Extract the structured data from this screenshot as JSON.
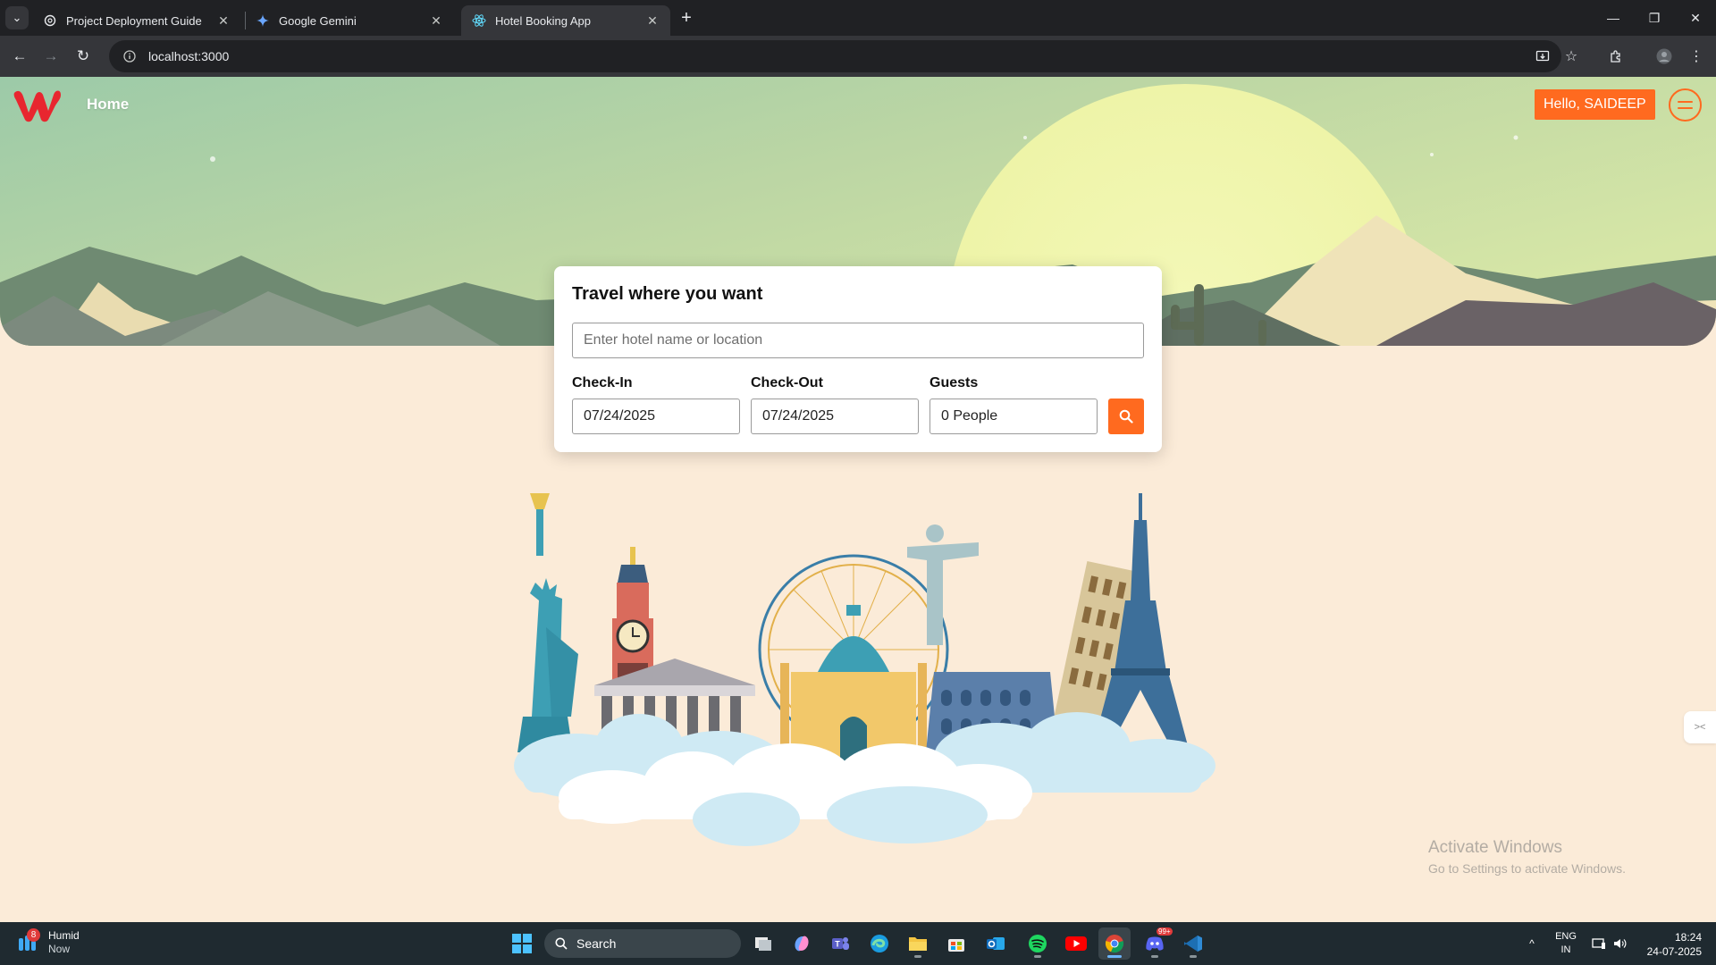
{
  "browser": {
    "tabs": [
      {
        "title": "Project Deployment Guide",
        "icon": "openai-icon",
        "active": false
      },
      {
        "title": "Google Gemini",
        "icon": "gemini-icon",
        "active": false
      },
      {
        "title": "Hotel Booking App",
        "icon": "react-icon",
        "active": true
      }
    ],
    "url": "localhost:3000"
  },
  "app": {
    "nav": {
      "home_label": "Home"
    },
    "greeting": "Hello, SAIDEEP",
    "search": {
      "title": "Travel where you want",
      "placeholder": "Enter hotel name or location",
      "checkin_label": "Check-In",
      "checkin_value": "07/24/2025",
      "checkout_label": "Check-Out",
      "checkout_value": "07/24/2025",
      "guests_label": "Guests",
      "guests_value": "0 People"
    },
    "accent_color": "#ff6a1f",
    "background_color": "#fbebd8"
  },
  "watermark": {
    "line1": "Activate Windows",
    "line2": "Go to Settings to activate Windows."
  },
  "taskbar": {
    "weather": {
      "title": "Humid",
      "subtitle": "Now",
      "badge": "8"
    },
    "search_label": "Search",
    "language": {
      "line1": "ENG",
      "line2": "IN"
    },
    "time": "18:24",
    "date": "24-07-2025",
    "apps": [
      "windows-start-icon",
      "task-view-icon",
      "copilot-icon",
      "teams-icon",
      "edge-icon",
      "file-explorer-icon",
      "store-icon",
      "outlook-icon",
      "spotify-icon",
      "youtube-icon",
      "chrome-icon",
      "discord-icon",
      "vscode-icon"
    ],
    "discord_badge": "99+"
  }
}
